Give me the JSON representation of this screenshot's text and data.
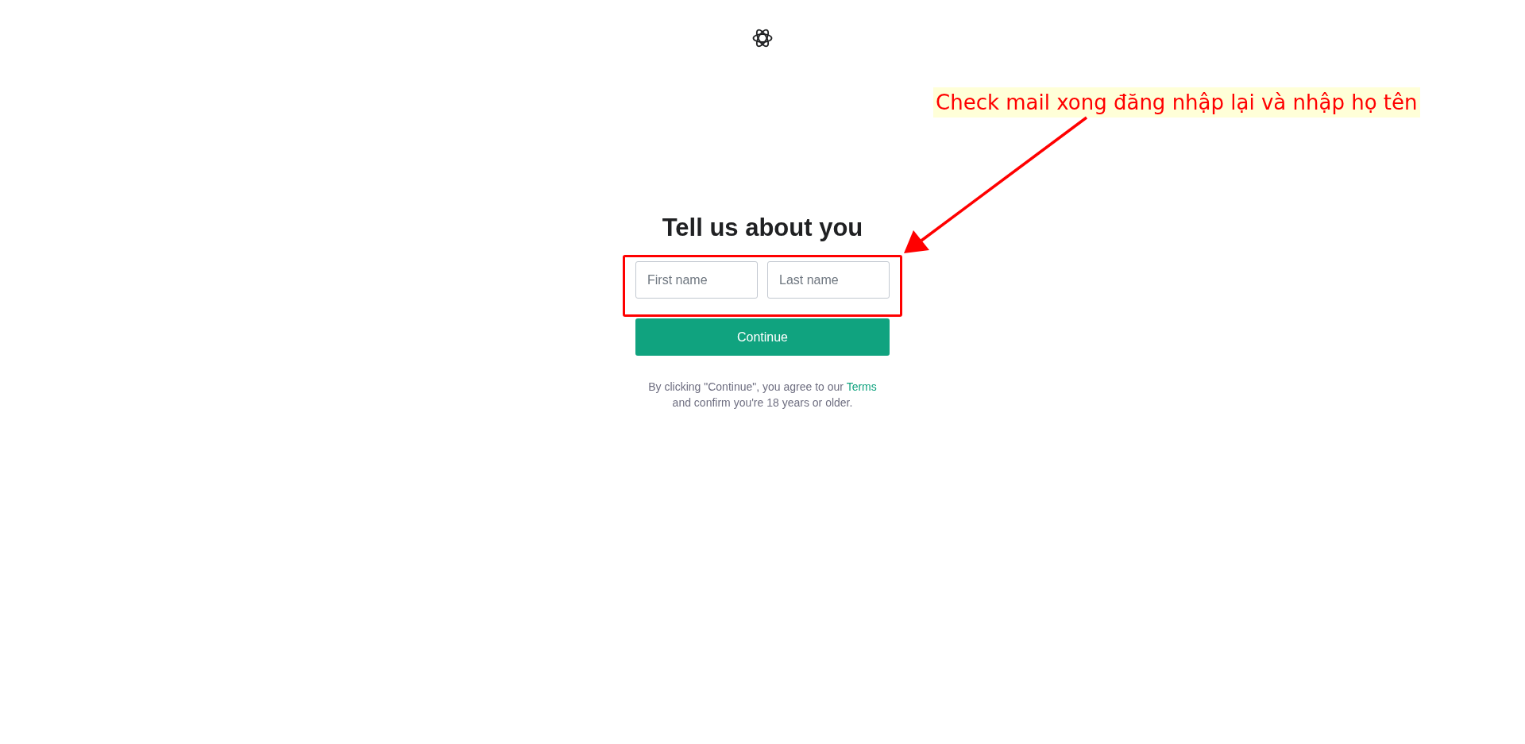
{
  "heading": "Tell us about you",
  "fields": [
    {
      "placeholder": "First name"
    },
    {
      "placeholder": "Last name"
    }
  ],
  "continue_button": "Continue",
  "legal": {
    "text_before": "By clicking \"Continue\", you agree to our",
    "link": "Terms",
    "text_after": "and confirm you're 18 years or older."
  },
  "annotation": {
    "text": "Check mail xong đăng nhập lại và nhập họ tên"
  }
}
